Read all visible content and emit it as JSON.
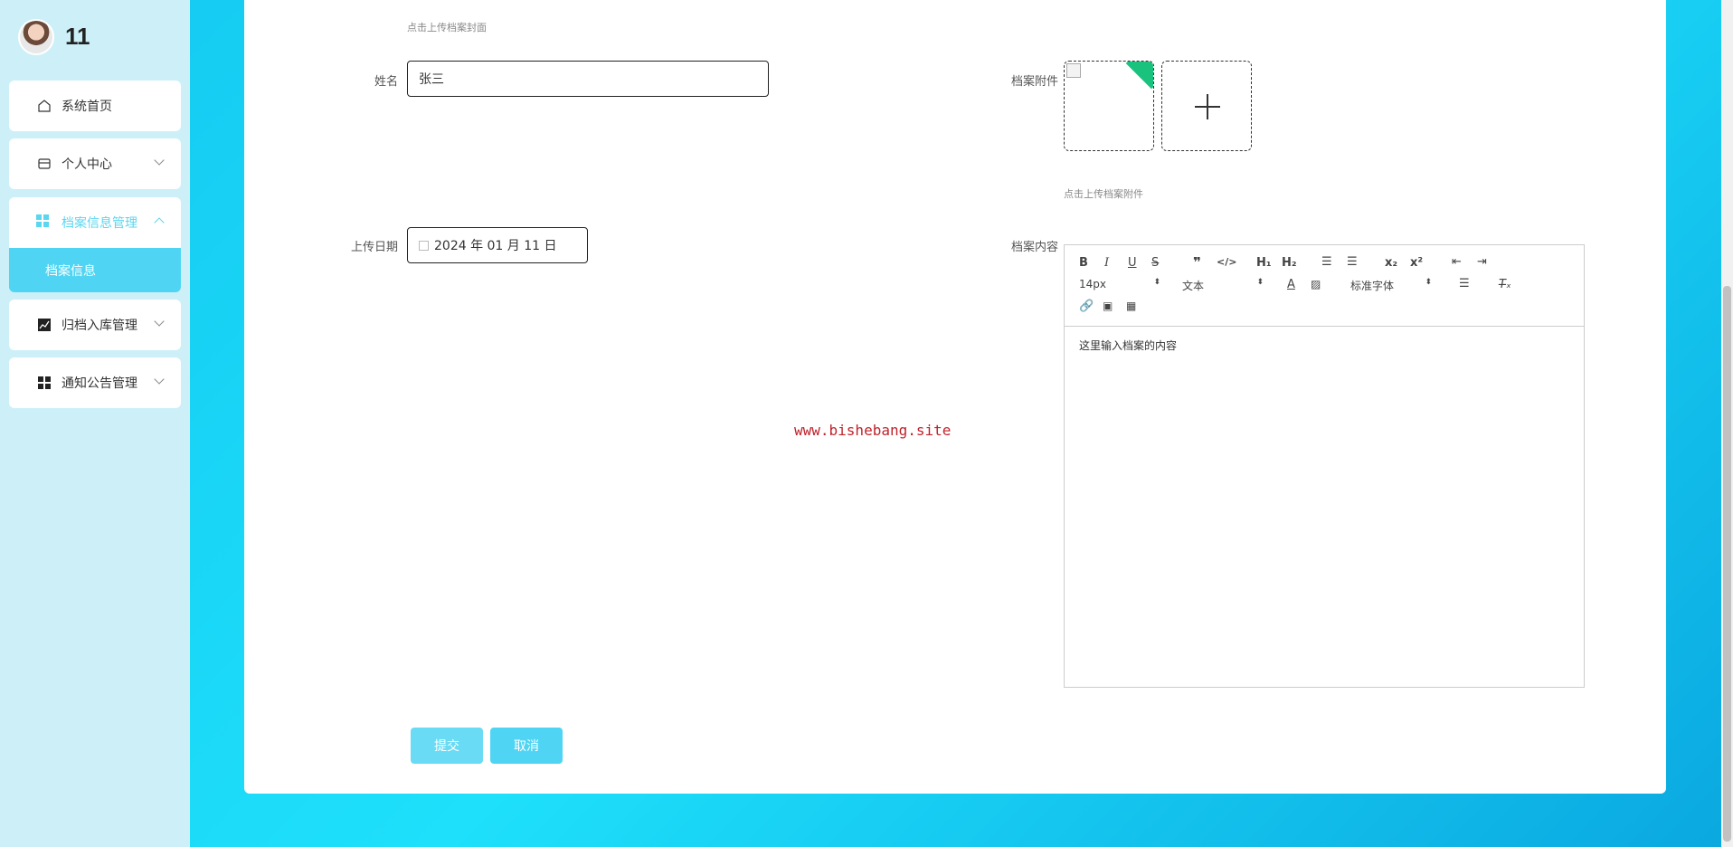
{
  "user": {
    "name": "11"
  },
  "sidebar": {
    "items": [
      {
        "label": "系统首页"
      },
      {
        "label": "个人中心"
      },
      {
        "label": "档案信息管理",
        "sub": "档案信息"
      },
      {
        "label": "归档入库管理"
      },
      {
        "label": "通知公告管理"
      }
    ]
  },
  "form": {
    "cover_hint": "点击上传档案封面",
    "name_label": "姓名",
    "name_value": "张三",
    "date_label": "上传日期",
    "date_value": "2024 年 01 月 11 日",
    "attach_label": "档案附件",
    "attach_hint": "点击上传档案附件",
    "content_label": "档案内容",
    "content_text": "这里输入档案的内容"
  },
  "editor": {
    "font_size": "14px",
    "block_format": "文本",
    "font_family": "标准字体"
  },
  "watermark": "www.bishebang.site",
  "buttons": {
    "submit": "提交",
    "cancel": "取消"
  },
  "colors": {
    "accent": "#4fd5f3",
    "sidebar_bg": "#cdf0f8",
    "corner_badge": "#19c37d"
  }
}
